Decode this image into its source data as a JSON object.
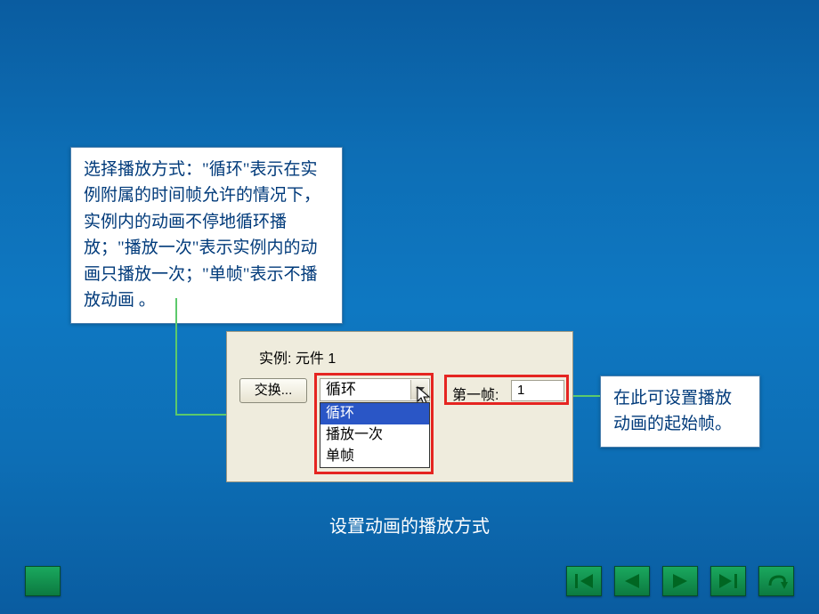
{
  "callout_left": "选择播放方式：\"循环\"表示在实例附属的时间帧允许的情况下，实例内的动画不停地循环播放；\"播放一次\"表示实例内的动画只播放一次；\"单帧\"表示不播放动画 。",
  "callout_right": "在此可设置播放动画的起始帧。",
  "panel": {
    "instance_label": "实例:",
    "instance_name": "元件 1",
    "swap_label": "交换...",
    "loop_selected": "循环",
    "loop_options": [
      "循环",
      "播放一次",
      "单帧"
    ],
    "first_frame_label": "第一帧:",
    "first_frame_value": "1"
  },
  "caption": "设置动画的播放方式",
  "nav": {
    "first": "first-icon",
    "prev": "prev-icon",
    "next": "next-icon",
    "last": "last-icon",
    "return": "return-icon"
  }
}
